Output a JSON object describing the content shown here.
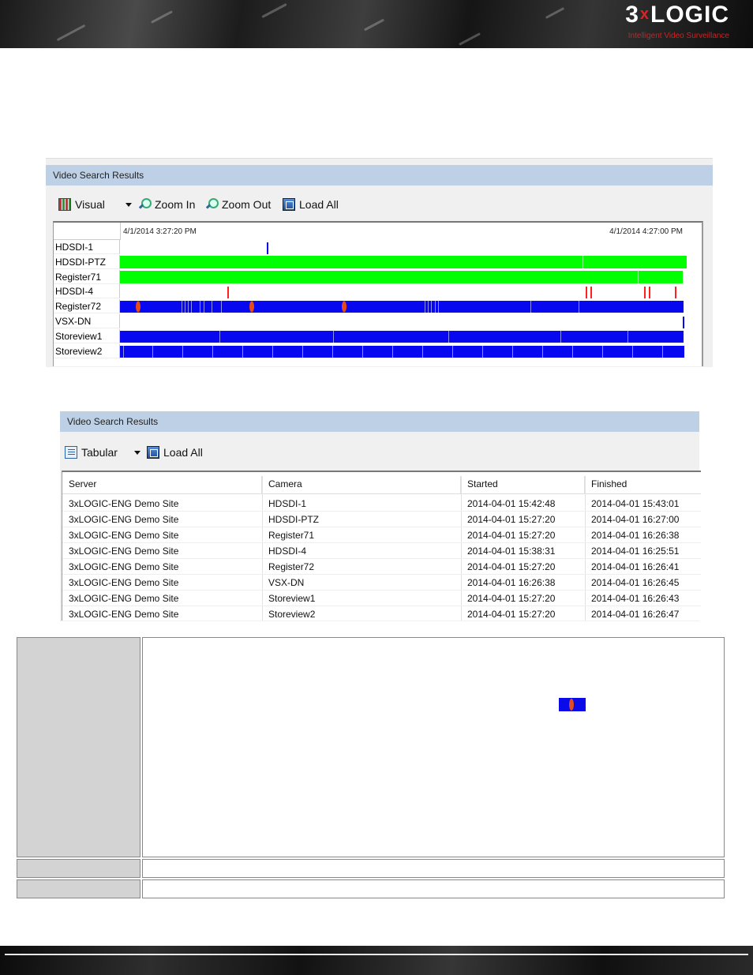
{
  "header": {
    "brand_prefix": "3",
    "brand_x": "x",
    "brand_suffix": "LOGIC",
    "tagline": "Intelligent Video Surveillance"
  },
  "visual_panel": {
    "title": "Video Search Results",
    "toolbar": {
      "mode_label": "Visual",
      "zoom_in_label": "Zoom In",
      "zoom_out_label": "Zoom Out",
      "load_all_label": "Load All"
    },
    "start_time": "4/1/2014 3:27:20 PM",
    "end_time": "4/1/2014 4:27:00 PM",
    "colors": {
      "green": "#00ff00",
      "blue": "#0808f0",
      "red": "#ff2020",
      "event": "#e84a1a"
    },
    "tracks": [
      {
        "name": "HDSDI-1"
      },
      {
        "name": "HDSDI-PTZ"
      },
      {
        "name": "Register71"
      },
      {
        "name": "HDSDI-4"
      },
      {
        "name": "Register72"
      },
      {
        "name": "VSX-DN"
      },
      {
        "name": "Storeview1"
      },
      {
        "name": "Storeview2"
      }
    ]
  },
  "tabular_panel": {
    "title": "Video Search Results",
    "toolbar": {
      "mode_label": "Tabular",
      "load_all_label": "Load All"
    },
    "columns": [
      "Server",
      "Camera",
      "Started",
      "Finished"
    ],
    "rows": [
      [
        "3xLOGIC-ENG Demo Site",
        "HDSDI-1",
        "2014-04-01 15:42:48",
        "2014-04-01 15:43:01"
      ],
      [
        "3xLOGIC-ENG Demo Site",
        "HDSDI-PTZ",
        "2014-04-01 15:27:20",
        "2014-04-01 16:27:00"
      ],
      [
        "3xLOGIC-ENG Demo Site",
        "Register71",
        "2014-04-01 15:27:20",
        "2014-04-01 16:26:38"
      ],
      [
        "3xLOGIC-ENG Demo Site",
        "HDSDI-4",
        "2014-04-01 15:38:31",
        "2014-04-01 16:25:51"
      ],
      [
        "3xLOGIC-ENG Demo Site",
        "Register72",
        "2014-04-01 15:27:20",
        "2014-04-01 16:26:41"
      ],
      [
        "3xLOGIC-ENG Demo Site",
        "VSX-DN",
        "2014-04-01 16:26:38",
        "2014-04-01 16:26:45"
      ],
      [
        "3xLOGIC-ENG Demo Site",
        "Storeview1",
        "2014-04-01 15:27:20",
        "2014-04-01 16:26:43"
      ],
      [
        "3xLOGIC-ENG Demo Site",
        "Storeview2",
        "2014-04-01 15:27:20",
        "2014-04-01 16:26:47"
      ]
    ]
  }
}
